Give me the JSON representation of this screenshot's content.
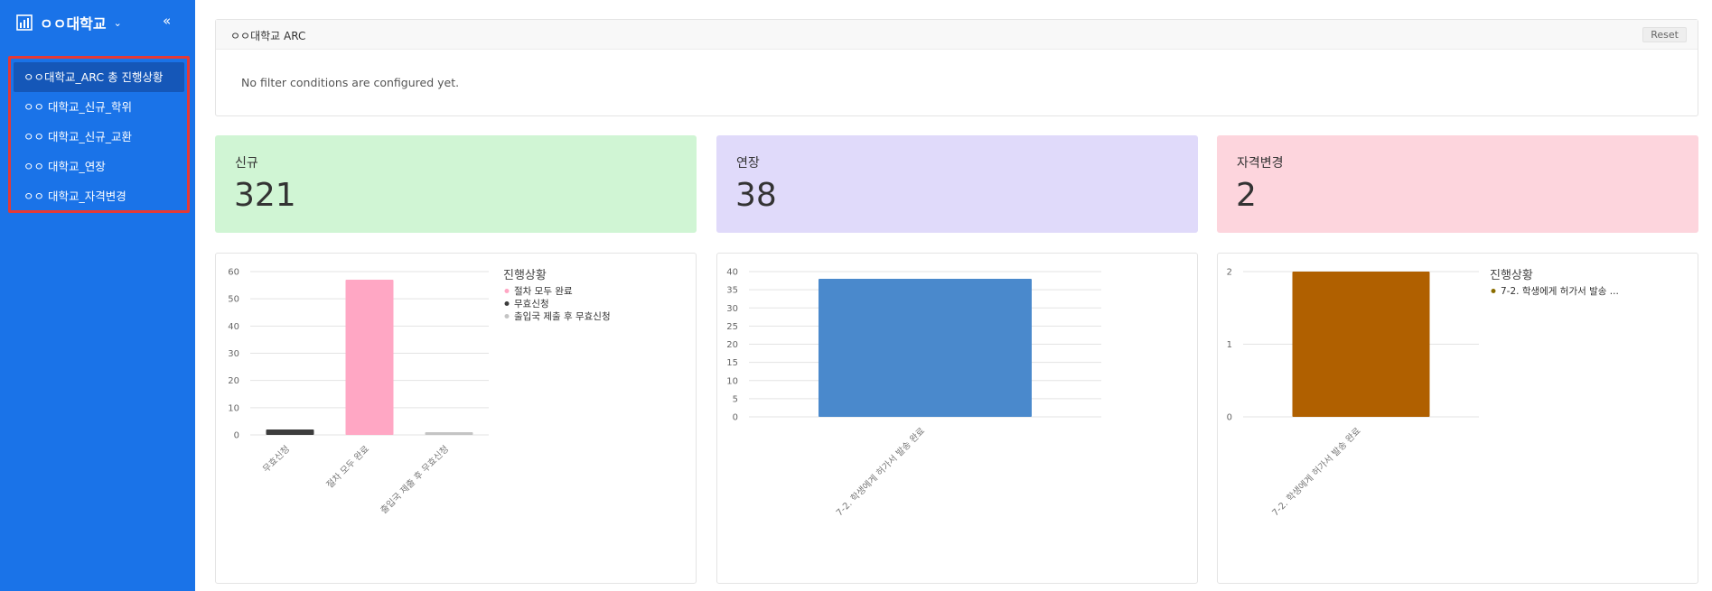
{
  "sidebar": {
    "brand": "ㅇㅇ대학교",
    "items": [
      {
        "label": "ㅇㅇ대학교_ARC 총 진행상황",
        "active": true
      },
      {
        "label": "ㅇㅇ 대학교_신규_학위",
        "active": false
      },
      {
        "label": "ㅇㅇ 대학교_신규_교환",
        "active": false
      },
      {
        "label": "ㅇㅇ 대학교_연장",
        "active": false
      },
      {
        "label": "ㅇㅇ 대학교_자격변경",
        "active": false
      }
    ]
  },
  "filter": {
    "title": "ㅇㅇ대학교 ARC",
    "reset_label": "Reset",
    "message": "No filter conditions are configured yet."
  },
  "cards": [
    {
      "label": "신규",
      "value": "321",
      "color": "#d0f5d4"
    },
    {
      "label": "연장",
      "value": "38",
      "color": "#e0dafa"
    },
    {
      "label": "자격변경",
      "value": "2",
      "color": "#fdd5dd"
    }
  ],
  "chart_data": [
    {
      "type": "bar",
      "categories": [
        "무효신청",
        "절차 모두 완료",
        "출입국 제출 후 무효신청"
      ],
      "values": [
        2,
        57,
        1
      ],
      "colors": [
        "#3d3d3d",
        "#ffa7c4",
        "#c4c4c4"
      ],
      "ylim": [
        0,
        60
      ],
      "yticks": [
        0,
        10,
        20,
        30,
        40,
        50,
        60
      ],
      "grid": true,
      "legend": {
        "title": "진행상황",
        "placement": "right",
        "entries": [
          {
            "label": "절차 모두 완료",
            "color": "#ffa7c4"
          },
          {
            "label": "무효신청",
            "color": "#3d3d3d"
          },
          {
            "label": "출입국 제출 후 무효신청",
            "color": "#c4c4c4"
          }
        ]
      }
    },
    {
      "type": "bar",
      "categories": [
        "7-2. 학생에게 허가서 발송 완료"
      ],
      "values": [
        38
      ],
      "colors": [
        "#4a89cc"
      ],
      "ylim": [
        0,
        40
      ],
      "yticks": [
        0,
        5,
        10,
        15,
        20,
        25,
        30,
        35,
        40
      ],
      "grid": true,
      "legend": null
    },
    {
      "type": "bar",
      "categories": [
        "7-2. 학생에게 허가서 발송 완료"
      ],
      "values": [
        2
      ],
      "colors": [
        "#b06000"
      ],
      "ylim": [
        0,
        2
      ],
      "yticks": [
        0,
        1,
        2
      ],
      "grid": true,
      "legend": {
        "title": "진행상황",
        "placement": "right",
        "entries": [
          {
            "label": "7-2. 학생에게 허가서 발송 ...",
            "color": "#8a6d00"
          }
        ]
      }
    }
  ]
}
